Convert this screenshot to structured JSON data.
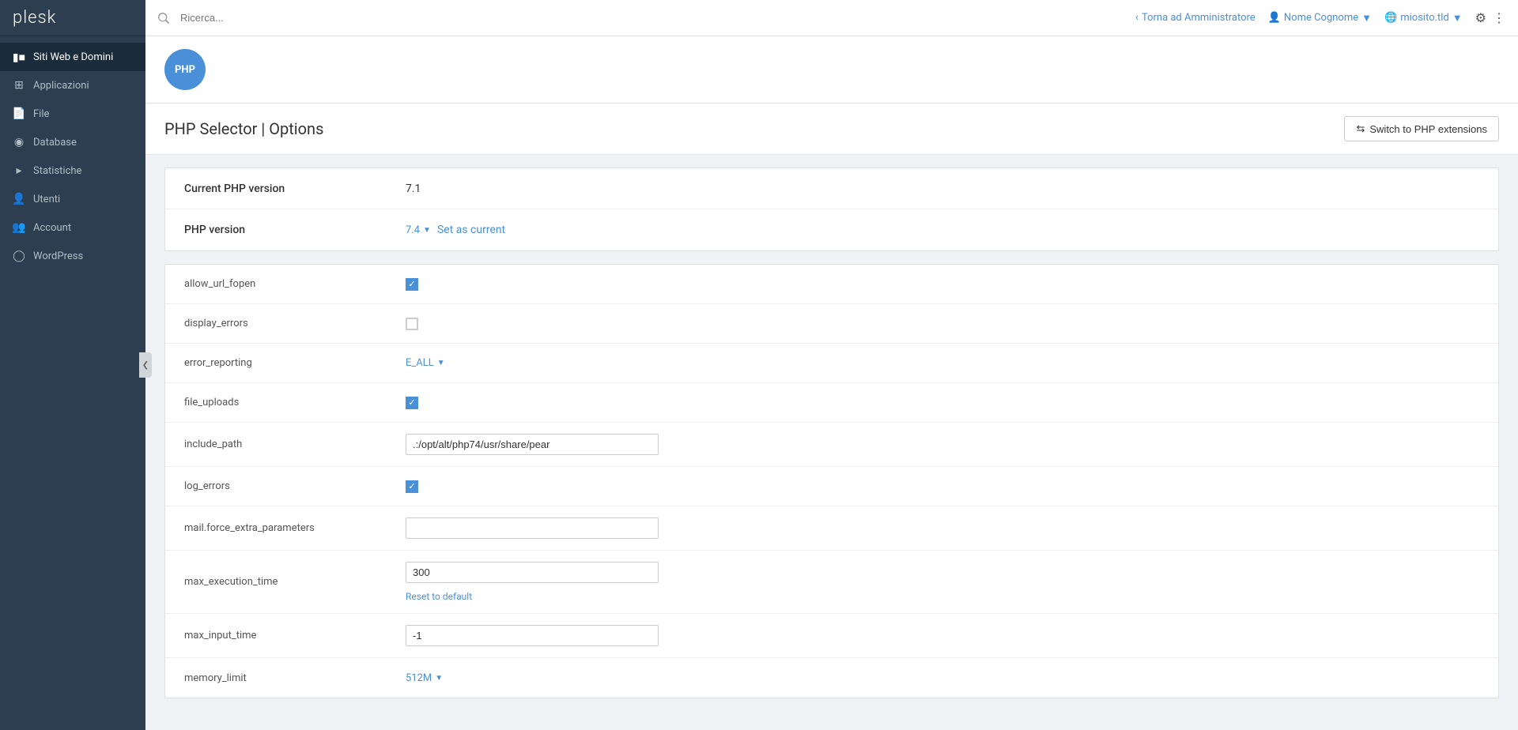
{
  "topbar": {
    "search_placeholder": "Ricerca...",
    "back_link": "Torna ad Amministratore",
    "user_name": "Nome Cognome",
    "domain": "miosito.tld"
  },
  "sidebar": {
    "logo": "plesk",
    "items": [
      {
        "id": "siti-web",
        "label": "Siti Web e Domini",
        "icon": "monitor",
        "active": true
      },
      {
        "id": "applicazioni",
        "label": "Applicazioni",
        "icon": "grid"
      },
      {
        "id": "file",
        "label": "File",
        "icon": "file"
      },
      {
        "id": "database",
        "label": "Database",
        "icon": "database"
      },
      {
        "id": "statistiche",
        "label": "Statistiche",
        "icon": "bar-chart"
      },
      {
        "id": "utenti",
        "label": "Utenti",
        "icon": "user"
      },
      {
        "id": "account",
        "label": "Account",
        "icon": "person"
      },
      {
        "id": "wordpress",
        "label": "WordPress",
        "icon": "wordpress"
      }
    ]
  },
  "page": {
    "title": "PHP Selector | Options",
    "switch_button": "Switch to PHP extensions",
    "current_php_label": "Current PHP version",
    "current_php_value": "7.1",
    "php_version_label": "PHP version",
    "php_version_value": "7.4",
    "set_as_current_link": "Set as current"
  },
  "options": [
    {
      "id": "allow_url_fopen",
      "label": "allow_url_fopen",
      "type": "checkbox",
      "checked": true
    },
    {
      "id": "display_errors",
      "label": "display_errors",
      "type": "checkbox",
      "checked": false
    },
    {
      "id": "error_reporting",
      "label": "error_reporting",
      "type": "dropdown",
      "value": "E_ALL"
    },
    {
      "id": "file_uploads",
      "label": "file_uploads",
      "type": "checkbox",
      "checked": true
    },
    {
      "id": "include_path",
      "label": "include_path",
      "type": "text",
      "value": ".:/opt/alt/php74/usr/share/pear"
    },
    {
      "id": "log_errors",
      "label": "log_errors",
      "type": "checkbox",
      "checked": true
    },
    {
      "id": "mail_force_extra_parameters",
      "label": "mail.force_extra_parameters",
      "type": "text",
      "value": ""
    },
    {
      "id": "max_execution_time",
      "label": "max_execution_time",
      "type": "text_with_reset",
      "value": "300",
      "reset_label": "Reset to default"
    },
    {
      "id": "max_input_time",
      "label": "max_input_time",
      "type": "text",
      "value": "-1"
    },
    {
      "id": "memory_limit",
      "label": "memory_limit",
      "type": "dropdown",
      "value": "512M"
    }
  ]
}
